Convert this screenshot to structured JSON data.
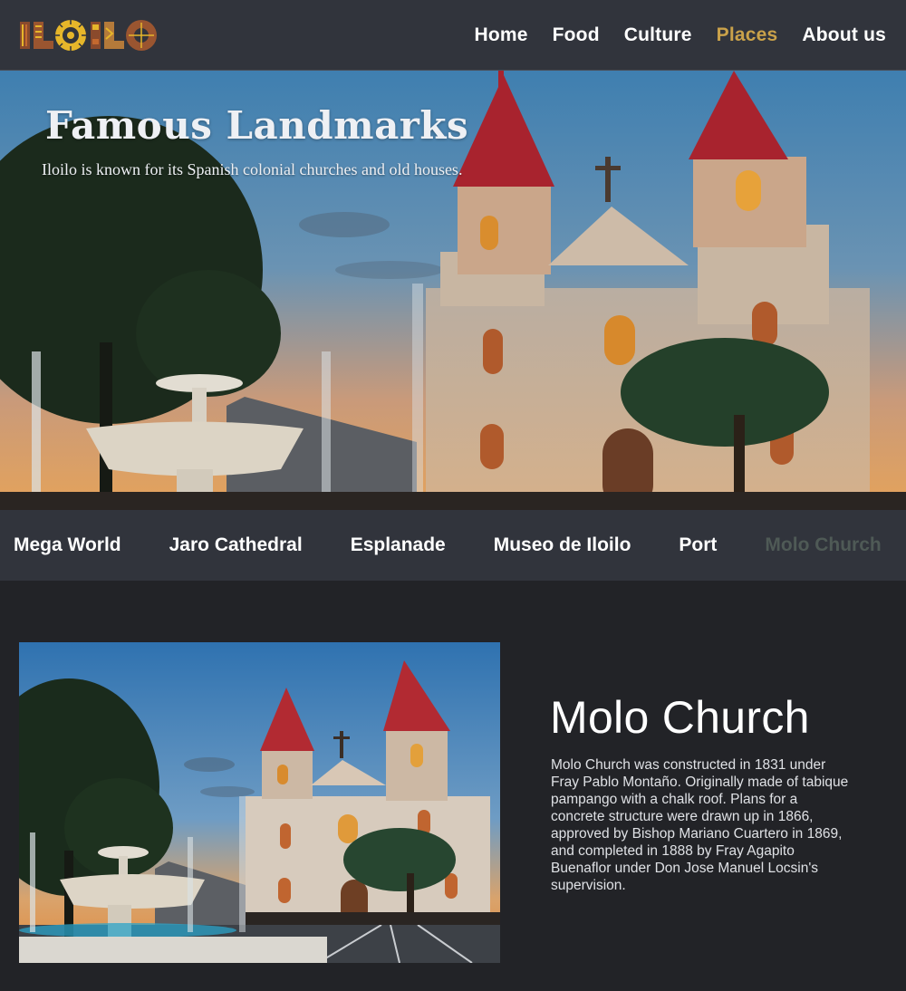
{
  "brand": {
    "logo_text": "ILOILO",
    "colors": {
      "accent": "#caa24a",
      "logo_brown": "#8a4a2c",
      "logo_gold": "#e6b62a"
    }
  },
  "nav": {
    "items": [
      {
        "label": "Home"
      },
      {
        "label": "Food"
      },
      {
        "label": "Culture"
      },
      {
        "label": "Places",
        "active": true
      },
      {
        "label": "About us"
      }
    ]
  },
  "hero": {
    "title": "Famous Landmarks",
    "subtitle": "Iloilo is known for its Spanish colonial churches and old houses."
  },
  "places": {
    "items": [
      {
        "label": "Mega World"
      },
      {
        "label": "Jaro Cathedral"
      },
      {
        "label": "Esplanade"
      },
      {
        "label": "Museo de Iloilo"
      },
      {
        "label": "Port"
      },
      {
        "label": "Molo Church",
        "active": true
      }
    ]
  },
  "detail": {
    "title": "Molo Church",
    "description": "Molo Church was constructed in 1831 under Fray Pablo Montaño. Originally made of tabique pampango with a chalk roof. Plans for a concrete structure were drawn up in 1866, approved by Bishop Mariano Cuartero in 1869, and completed in 1888 by Fray Agapito Buenaflor under Don Jose Manuel Locsin's supervision."
  }
}
